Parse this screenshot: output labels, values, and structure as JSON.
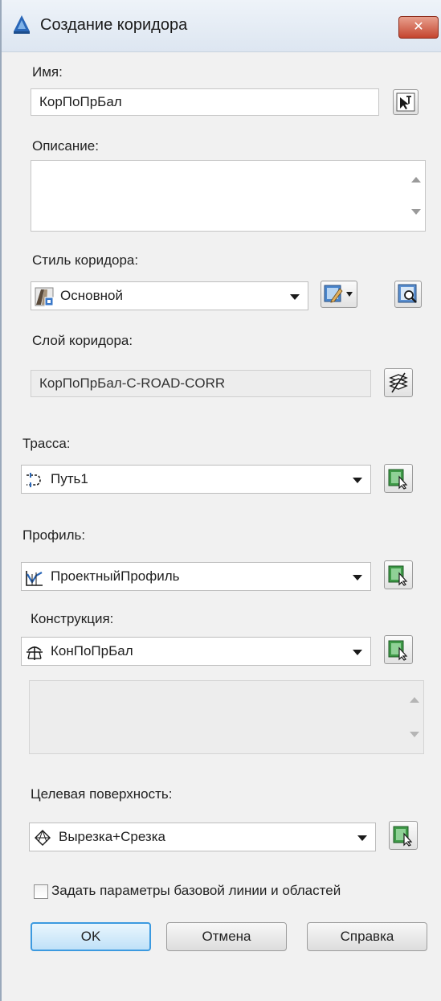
{
  "window": {
    "title": "Создание коридора",
    "close_label": "✕",
    "close_bg": "#c4452f"
  },
  "name": {
    "label": "Имя:",
    "value": "КорПоПрБал"
  },
  "description": {
    "label": "Описание:",
    "value": ""
  },
  "corridor_style": {
    "label": "Стиль коридора:",
    "value": "Основной"
  },
  "corridor_layer": {
    "label": "Слой коридора:",
    "value": "КорПоПрБал-C-ROAD-CORR"
  },
  "alignment": {
    "label": "Трасса:",
    "value": "Путь1"
  },
  "profile": {
    "label": "Профиль:",
    "value": "ПроектныйПрофиль"
  },
  "assembly": {
    "label": "Конструкция:",
    "value": "КонПоПрБал"
  },
  "target_surface": {
    "label": "Целевая поверхность:",
    "value": "Вырезка+Срезка"
  },
  "checkbox": {
    "label": "Задать параметры базовой линии и областей",
    "checked": false
  },
  "buttons": {
    "ok": "OK",
    "cancel": "Отмена",
    "help": "Справка"
  },
  "colors": {
    "accent": "#3c9ae0",
    "pick_icon": "#2f8a3a"
  }
}
